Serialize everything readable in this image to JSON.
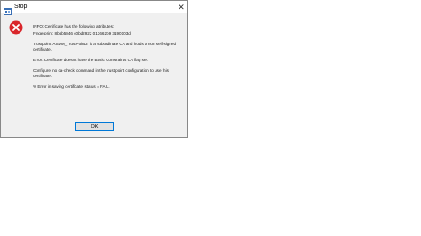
{
  "window": {
    "title": "Stop",
    "close_glyph": "✕",
    "title_icon": "app-icon",
    "close_icon": "close-icon"
  },
  "message": {
    "icon": "error-icon",
    "line1": "INFO: Certificate has the following attributes:",
    "line2": "Fingerprint: 8b5b5846 c0bd2922 013662b9 3190103d",
    "line3": "Trustpoint 'ASDM_TrustPoint3' is a subordinate CA and holds a non self-signed certificate.",
    "line4": "Error: Certificate doesn't have the Basic Constraints CA flag set.",
    "line5": "Configure 'no ca-check' command in the trust point configuration to use this certificate.",
    "line6": "% Error in saving certificate: status = FAIL."
  },
  "buttons": {
    "ok_label": "OK"
  },
  "colors": {
    "error_red": "#d9262b",
    "accent_blue": "#0078d7",
    "dialog_bg": "#f0f0f0"
  }
}
